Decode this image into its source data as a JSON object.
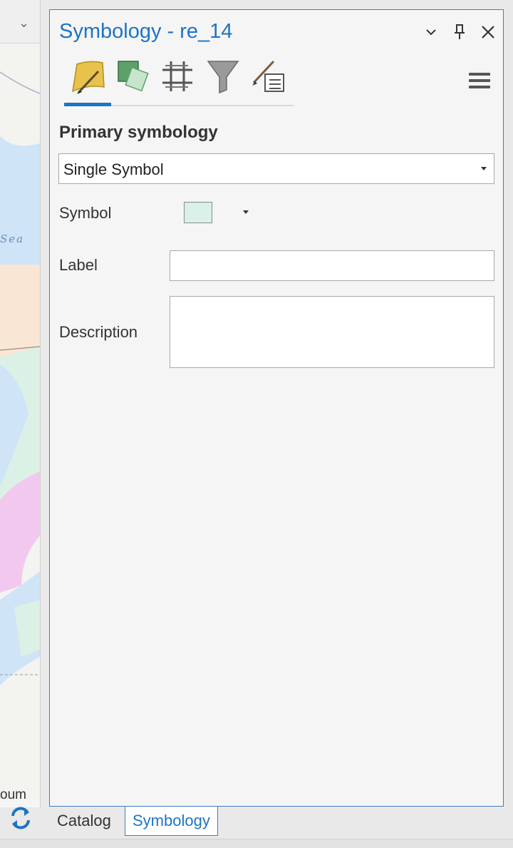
{
  "map": {
    "sea_label": "Sea",
    "bottom_label": "oum",
    "colors": {
      "water": "#cfe4f7",
      "land_green": "#dcf1e5",
      "land_peach": "#f9e6d3",
      "land_pink": "#f3c8ee"
    }
  },
  "pane": {
    "title": "Symbology - re_14",
    "controls": [
      "chevron-down-icon",
      "pin-icon",
      "close-icon"
    ],
    "tabs": [
      "primary-symbology-tab",
      "vary-symbology-tab",
      "symbol-layer-drawing-tab",
      "feature-filter-tab",
      "symbology-properties-tab"
    ],
    "primary_symbology_heading": "Primary symbology",
    "renderer": {
      "selected": "Single Symbol"
    },
    "symbol": {
      "label": "Symbol",
      "color": "#d9f1e8"
    },
    "label_field": {
      "label": "Label",
      "value": ""
    },
    "description_field": {
      "label": "Description",
      "value": ""
    }
  },
  "bottom_tabs": {
    "catalog": "Catalog",
    "symbology": "Symbology",
    "active": "Symbology"
  },
  "accent": "#1d74c4"
}
